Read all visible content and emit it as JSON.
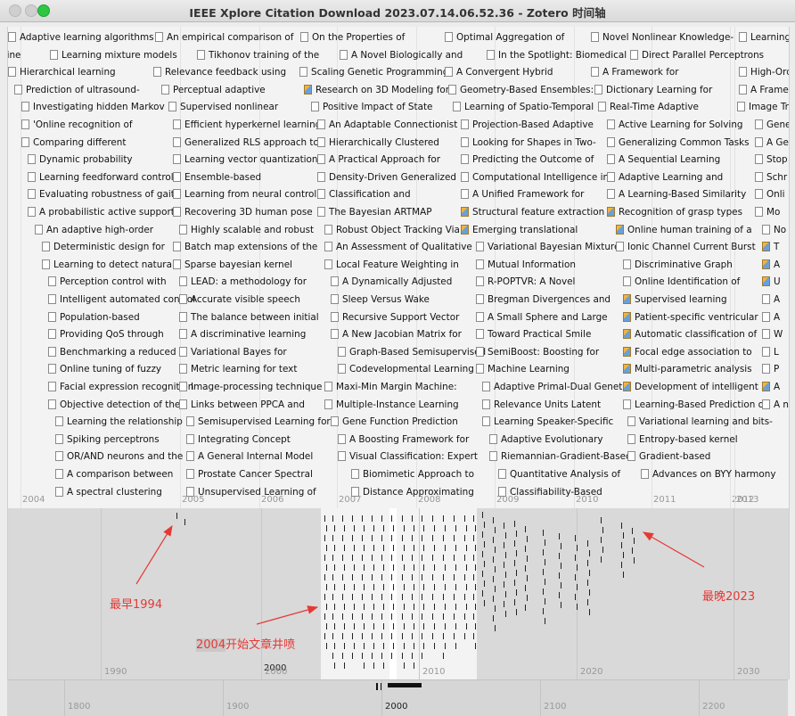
{
  "window": {
    "title": "IEEE Xplore Citation Download 2023.07.14.06.52.36 - Zotero 时间轴"
  },
  "accent_annotation_color": "#e53935",
  "band_main": {
    "year_labels": [
      "2004",
      "2005",
      "2006",
      "2007",
      "2008",
      "2009",
      "2010",
      "2011",
      "2012",
      "2013"
    ],
    "events": [
      {
        "t": "Adaptive learning algorithms",
        "i": "doc"
      },
      {
        "t": "An empirical comparison of",
        "i": "doc"
      },
      {
        "t": "On the Properties of",
        "i": "doc"
      },
      {
        "t": "Optimal Aggregation of",
        "i": "doc"
      },
      {
        "t": "Novel Nonlinear Knowledge-",
        "i": "doc"
      },
      {
        "t": "Learning",
        "i": "doc"
      },
      {
        "t": "hine",
        "i": "none"
      },
      {
        "t": "Learning mixture models",
        "i": "doc"
      },
      {
        "t": "Tikhonov training of the",
        "i": "doc"
      },
      {
        "t": "A Novel Biologically and",
        "i": "doc"
      },
      {
        "t": "In the Spotlight: Biomedical",
        "i": "doc"
      },
      {
        "t": "Direct Parallel Perceptrons",
        "i": "doc"
      },
      {
        "t": "Hierarchical learning",
        "i": "doc"
      },
      {
        "t": "Relevance feedback using",
        "i": "doc"
      },
      {
        "t": "Scaling Genetic Programming",
        "i": "doc"
      },
      {
        "t": "A Convergent Hybrid",
        "i": "doc"
      },
      {
        "t": "A Framework for",
        "i": "doc"
      },
      {
        "t": "High-Ord",
        "i": "doc"
      },
      {
        "t": "Prediction of ultrasound-",
        "i": "doc"
      },
      {
        "t": "Perceptual adaptive",
        "i": "doc"
      },
      {
        "t": "Research on 3D Modeling for",
        "i": "img"
      },
      {
        "t": "Geometry-Based Ensembles:",
        "i": "doc"
      },
      {
        "t": "Dictionary Learning for",
        "i": "doc"
      },
      {
        "t": "A Framew",
        "i": "doc"
      },
      {
        "t": "Investigating hidden Markov",
        "i": "doc"
      },
      {
        "t": "Supervised nonlinear",
        "i": "doc"
      },
      {
        "t": "Positive Impact of State",
        "i": "doc"
      },
      {
        "t": "Learning of Spatio-Temporal",
        "i": "doc"
      },
      {
        "t": "Real-Time Adaptive",
        "i": "doc"
      },
      {
        "t": "Image Tr",
        "i": "doc"
      },
      {
        "t": "'Online recognition of",
        "i": "doc"
      },
      {
        "t": "Efficient hyperkernel learning",
        "i": "doc"
      },
      {
        "t": "An Adaptable Connectionist",
        "i": "doc"
      },
      {
        "t": "Projection-Based Adaptive",
        "i": "doc"
      },
      {
        "t": "Active Learning for Solving",
        "i": "doc"
      },
      {
        "t": "Gene",
        "i": "doc"
      },
      {
        "t": "Comparing different",
        "i": "doc"
      },
      {
        "t": "Generalized RLS approach to",
        "i": "doc"
      },
      {
        "t": "Hierarchically Clustered",
        "i": "doc"
      },
      {
        "t": "Looking for Shapes in Two-",
        "i": "doc"
      },
      {
        "t": "Generalizing Common Tasks",
        "i": "doc"
      },
      {
        "t": "A Ge",
        "i": "doc"
      },
      {
        "t": "Dynamic probability",
        "i": "doc"
      },
      {
        "t": "Learning vector quantization",
        "i": "doc"
      },
      {
        "t": "A Practical Approach for",
        "i": "doc"
      },
      {
        "t": "Predicting the Outcome of",
        "i": "doc"
      },
      {
        "t": "A Sequential Learning",
        "i": "doc"
      },
      {
        "t": "Stop",
        "i": "doc"
      },
      {
        "t": "Learning feedforward control",
        "i": "doc"
      },
      {
        "t": "Ensemble-based",
        "i": "doc"
      },
      {
        "t": "Density-Driven Generalized",
        "i": "doc"
      },
      {
        "t": "Computational Intelligence in",
        "i": "doc"
      },
      {
        "t": "Adaptive Learning and",
        "i": "doc"
      },
      {
        "t": "Schr",
        "i": "doc"
      },
      {
        "t": "Evaluating robustness of gait",
        "i": "doc"
      },
      {
        "t": "Learning from neural control",
        "i": "doc"
      },
      {
        "t": "Classification and",
        "i": "doc"
      },
      {
        "t": "A Unified Framework for",
        "i": "doc"
      },
      {
        "t": "A Learning-Based Similarity",
        "i": "doc"
      },
      {
        "t": "Onli",
        "i": "doc"
      },
      {
        "t": "A probabilistic active support",
        "i": "doc"
      },
      {
        "t": "Recovering 3D human pose",
        "i": "doc"
      },
      {
        "t": "The Bayesian ARTMAP",
        "i": "doc"
      },
      {
        "t": "Structural feature extraction",
        "i": "img"
      },
      {
        "t": "Recognition of grasp types",
        "i": "img"
      },
      {
        "t": "Mo",
        "i": "doc"
      },
      {
        "t": "An adaptive high-order",
        "i": "doc"
      },
      {
        "t": "Highly scalable and robust",
        "i": "doc"
      },
      {
        "t": "Robust Object Tracking Via",
        "i": "doc"
      },
      {
        "t": "Emerging translational",
        "i": "img"
      },
      {
        "t": "Online human training of a",
        "i": "img"
      },
      {
        "t": "No",
        "i": "doc"
      },
      {
        "t": "Deterministic design for",
        "i": "doc"
      },
      {
        "t": "Batch map extensions of the",
        "i": "doc"
      },
      {
        "t": "An Assessment of Qualitative",
        "i": "doc"
      },
      {
        "t": "Variational Bayesian Mixture",
        "i": "doc"
      },
      {
        "t": "Ionic Channel Current Burst",
        "i": "doc"
      },
      {
        "t": "T",
        "i": "img"
      },
      {
        "t": "Learning to detect natural",
        "i": "doc"
      },
      {
        "t": "Sparse bayesian kernel",
        "i": "doc"
      },
      {
        "t": "Local Feature Weighting in",
        "i": "doc"
      },
      {
        "t": "Mutual Information",
        "i": "doc"
      },
      {
        "t": "Discriminative Graph",
        "i": "doc"
      },
      {
        "t": "A",
        "i": "img"
      },
      {
        "t": "Perception control with",
        "i": "doc"
      },
      {
        "t": "LEAD: a methodology for",
        "i": "doc"
      },
      {
        "t": "A Dynamically Adjusted",
        "i": "doc"
      },
      {
        "t": "R-POPTVR: A Novel",
        "i": "doc"
      },
      {
        "t": "Online Identification of",
        "i": "doc"
      },
      {
        "t": "U",
        "i": "img"
      },
      {
        "t": "Intelligent automated control",
        "i": "doc"
      },
      {
        "t": "Accurate visible speech",
        "i": "doc"
      },
      {
        "t": "Sleep Versus Wake",
        "i": "doc"
      },
      {
        "t": "Bregman Divergences and",
        "i": "doc"
      },
      {
        "t": "Supervised learning",
        "i": "img"
      },
      {
        "t": "A",
        "i": "doc"
      },
      {
        "t": "Population-based",
        "i": "doc"
      },
      {
        "t": "The balance between initial",
        "i": "doc"
      },
      {
        "t": "Recursive Support Vector",
        "i": "doc"
      },
      {
        "t": "A Small Sphere and Large",
        "i": "doc"
      },
      {
        "t": "Patient-specific ventricular",
        "i": "img"
      },
      {
        "t": "A",
        "i": "doc"
      },
      {
        "t": "Providing QoS through",
        "i": "doc"
      },
      {
        "t": "A discriminative learning",
        "i": "doc"
      },
      {
        "t": "A New Jacobian Matrix for",
        "i": "doc"
      },
      {
        "t": "Toward Practical Smile",
        "i": "doc"
      },
      {
        "t": "Automatic classification of",
        "i": "img"
      },
      {
        "t": "W",
        "i": "doc"
      },
      {
        "t": "Benchmarking a reduced",
        "i": "doc"
      },
      {
        "t": "Variational Bayes for",
        "i": "doc"
      },
      {
        "t": "Graph-Based Semisupervised",
        "i": "doc"
      },
      {
        "t": "SemiBoost: Boosting for",
        "i": "doc"
      },
      {
        "t": "Focal edge association to",
        "i": "img"
      },
      {
        "t": "L",
        "i": "doc"
      },
      {
        "t": "Online tuning of fuzzy",
        "i": "doc"
      },
      {
        "t": "Metric learning for text",
        "i": "doc"
      },
      {
        "t": "Codevelopmental Learning",
        "i": "doc"
      },
      {
        "t": "Machine Learning",
        "i": "doc"
      },
      {
        "t": "Multi-parametric analysis",
        "i": "img"
      },
      {
        "t": "P",
        "i": "doc"
      },
      {
        "t": "Facial expression recognition",
        "i": "doc"
      },
      {
        "t": "Image-processing technique",
        "i": "doc"
      },
      {
        "t": "Maxi-Min Margin Machine:",
        "i": "doc"
      },
      {
        "t": "Adaptive Primal-Dual Genetic",
        "i": "doc"
      },
      {
        "t": "Development of intelligent",
        "i": "img"
      },
      {
        "t": "A",
        "i": "img"
      },
      {
        "t": "Objective detection of the",
        "i": "doc"
      },
      {
        "t": "Links between PPCA and",
        "i": "doc"
      },
      {
        "t": "Multiple-Instance Learning",
        "i": "doc"
      },
      {
        "t": "Relevance Units Latent",
        "i": "doc"
      },
      {
        "t": "Learning-Based Prediction of",
        "i": "doc"
      },
      {
        "t": "A new criterion using",
        "i": "doc"
      },
      {
        "t": "Learning the relationship",
        "i": "doc"
      },
      {
        "t": "Semisupervised Learning for",
        "i": "doc"
      },
      {
        "t": "Gene Function Prediction",
        "i": "doc"
      },
      {
        "t": "Learning Speaker-Specific",
        "i": "doc"
      },
      {
        "t": "Variational learning and bits-",
        "i": "doc"
      },
      {
        "t": "Spiking perceptrons",
        "i": "doc"
      },
      {
        "t": "Integrating Concept",
        "i": "doc"
      },
      {
        "t": "A Boosting Framework for",
        "i": "doc"
      },
      {
        "t": "Adaptive Evolutionary",
        "i": "doc"
      },
      {
        "t": "Entropy-based kernel",
        "i": "doc"
      },
      {
        "t": "OR/AND neurons and the",
        "i": "doc"
      },
      {
        "t": "A General Internal Model",
        "i": "doc"
      },
      {
        "t": "Visual Classification: Expert",
        "i": "doc"
      },
      {
        "t": "Riemannian-Gradient-Based",
        "i": "doc"
      },
      {
        "t": "Gradient-based",
        "i": "doc"
      },
      {
        "t": "A comparison between",
        "i": "doc"
      },
      {
        "t": "Prostate Cancer Spectral",
        "i": "doc"
      },
      {
        "t": "Biomimetic Approach to",
        "i": "doc"
      },
      {
        "t": "Quantitative Analysis of",
        "i": "doc"
      },
      {
        "t": "Advances on BYY harmony",
        "i": "doc"
      },
      {
        "t": "A spectral clustering",
        "i": "doc"
      },
      {
        "t": "Unsupervised Learning of",
        "i": "doc"
      },
      {
        "t": "Distance Approximating",
        "i": "doc"
      },
      {
        "t": "Classifiability-Based",
        "i": "doc"
      }
    ]
  },
  "band_overview": {
    "year_labels": [
      "1990",
      "2000",
      "2010",
      "2020",
      "2030"
    ],
    "center_label": "2000"
  },
  "band_century": {
    "year_labels": [
      "1800",
      "1900",
      "2000",
      "2100",
      "2200"
    ]
  },
  "annotations": {
    "earliest": "最早1994",
    "latest": "最晚2023",
    "burst_prefix": "2004",
    "burst_rest": "开始文章井喷"
  }
}
